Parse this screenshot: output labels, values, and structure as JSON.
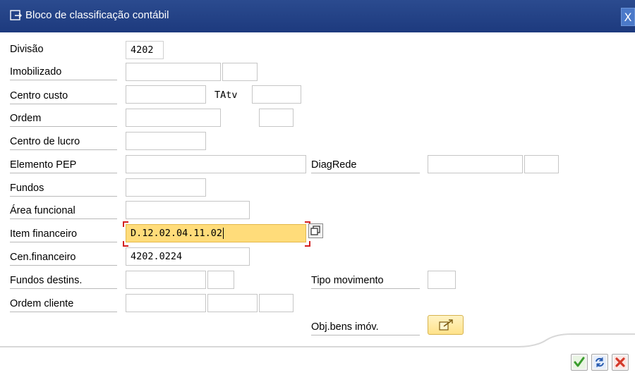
{
  "window": {
    "title": "Bloco de classificação contábil",
    "close_label": "X"
  },
  "fields": {
    "divisao": {
      "label": "Divisão",
      "value": "4202"
    },
    "imobilizado": {
      "label": "Imobilizado",
      "value": "",
      "sub_value": ""
    },
    "centro_custo": {
      "label": "Centro custo",
      "value": ""
    },
    "tatv": {
      "label": "TAtv",
      "value": ""
    },
    "ordem": {
      "label": "Ordem",
      "value": "",
      "sub_value": ""
    },
    "centro_lucro": {
      "label": "Centro de lucro",
      "value": ""
    },
    "elemento_pep": {
      "label": "Elemento PEP",
      "value": ""
    },
    "diagrede": {
      "label": "DiagRede",
      "value": "",
      "sub_value": ""
    },
    "fundos": {
      "label": "Fundos",
      "value": ""
    },
    "area_funcional": {
      "label": "Área funcional",
      "value": ""
    },
    "item_financeiro": {
      "label": "Item financeiro",
      "value": "D.12.02.04.11.02"
    },
    "cen_financeiro": {
      "label": "Cen.financeiro",
      "value": "4202.0224"
    },
    "fundos_destins": {
      "label": "Fundos destins.",
      "value": "",
      "sub_value": ""
    },
    "tipo_movimento": {
      "label": "Tipo movimento",
      "value": ""
    },
    "ordem_cliente": {
      "label": "Ordem cliente",
      "value": "",
      "sub_value": "",
      "sub_value2": ""
    },
    "obj_bens": {
      "label": "Obj.bens imóv."
    }
  },
  "colors": {
    "title_bar": "#1d3a7e",
    "focus_field": "#ffdc7a",
    "accept_green": "#3a9c2e",
    "cancel_red": "#d43a2a"
  }
}
